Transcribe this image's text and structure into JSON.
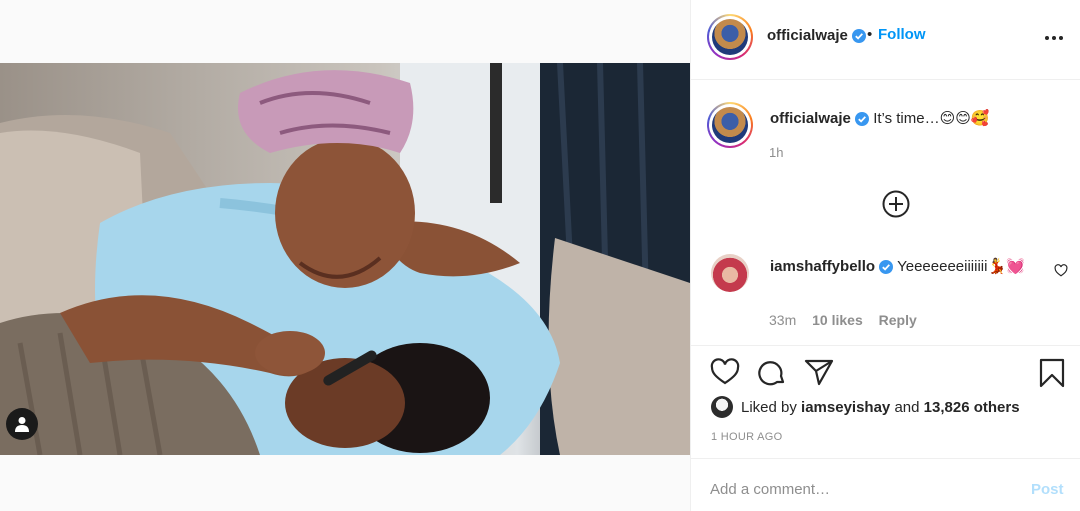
{
  "post": {
    "author": "officialwaje",
    "follow_label": "Follow",
    "dot": "•",
    "caption": "It’s time…😊😊🥰",
    "caption_time": "1h"
  },
  "comment": {
    "author": "iamshaffybello",
    "text": "Yeeeeeeeiiiiiii💃💓",
    "time": "33m",
    "likes": "10 likes",
    "reply_label": "Reply"
  },
  "likes": {
    "prefix": "Liked by",
    "user": "iamseyishay",
    "connector": "and",
    "others": "13,826 others"
  },
  "time_ago": "1 HOUR AGO",
  "add_comment": {
    "placeholder": "Add a comment…",
    "post_label": "Post"
  },
  "colors": {
    "link_blue": "#0095f6",
    "post_disabled": "#b2dffc",
    "muted": "#8e8e8e"
  },
  "icons": [
    "verified-badge-icon",
    "more-options-icon",
    "load-more-comments-icon",
    "heart-icon",
    "comment-icon",
    "share-icon",
    "save-bookmark-icon",
    "user-tag-icon"
  ]
}
